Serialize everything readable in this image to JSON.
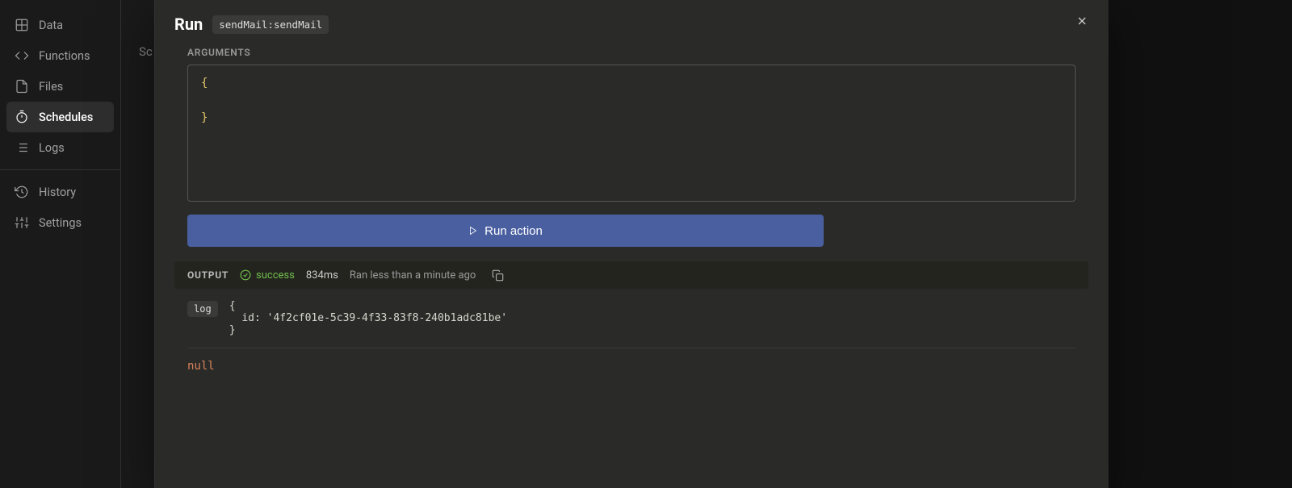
{
  "sidebar": {
    "items": [
      {
        "label": "Data"
      },
      {
        "label": "Functions"
      },
      {
        "label": "Files"
      },
      {
        "label": "Schedules"
      },
      {
        "label": "Logs"
      }
    ],
    "secondary": [
      {
        "label": "History"
      },
      {
        "label": "Settings"
      }
    ]
  },
  "background": {
    "tab_partial": "Sc"
  },
  "modal": {
    "title": "Run",
    "badge": "sendMail:sendMail",
    "arguments_label": "ARGUMENTS",
    "arguments_value": "{\n\n}",
    "run_button_label": "Run action",
    "output": {
      "label": "OUTPUT",
      "status": "success",
      "duration": "834ms",
      "ago": "Ran less than a minute ago"
    },
    "log": {
      "badge": "log",
      "content": "{\n  id: '4f2cf01e-5c39-4f33-83f8-240b1adc81be'\n}"
    },
    "result": "null"
  }
}
